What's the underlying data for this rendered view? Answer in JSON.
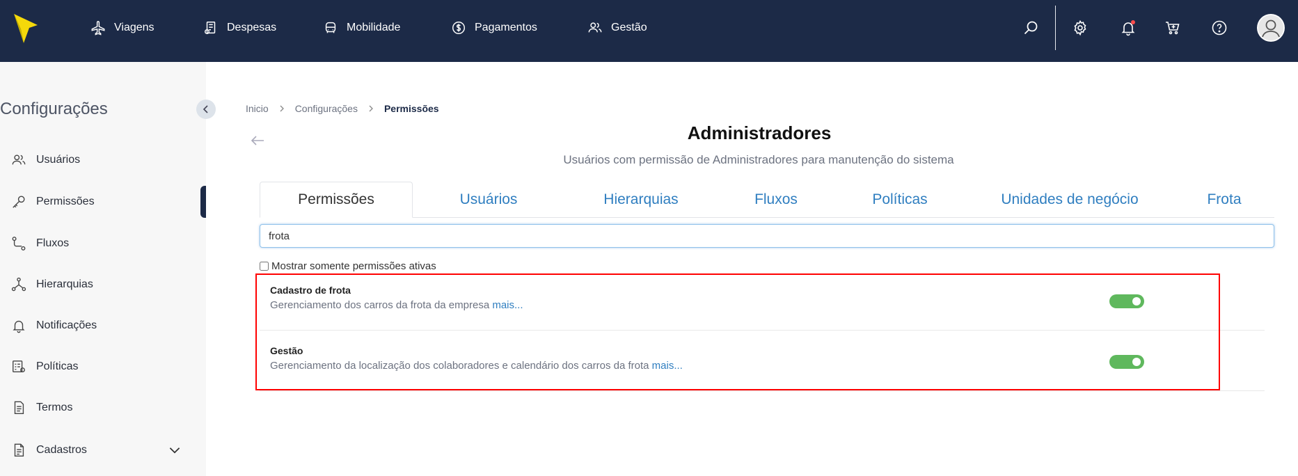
{
  "topnav": {
    "items": [
      {
        "label": "Viagens",
        "icon": "plane-icon"
      },
      {
        "label": "Despesas",
        "icon": "receipt-icon"
      },
      {
        "label": "Mobilidade",
        "icon": "car-icon"
      },
      {
        "label": "Pagamentos",
        "icon": "dollar-icon"
      },
      {
        "label": "Gestão",
        "icon": "people-icon"
      }
    ],
    "tools": [
      "search-icon",
      "gear-icon",
      "bell-icon",
      "cart-icon",
      "help-icon",
      "avatar-icon"
    ],
    "colors": {
      "bar": "#1c2a47",
      "logo": "#f5d90a",
      "notification": "#ff4d4d"
    }
  },
  "sidebar": {
    "title": "Configurações",
    "items": [
      {
        "label": "Usuários",
        "icon": "users-icon"
      },
      {
        "label": "Permissões",
        "icon": "key-icon"
      },
      {
        "label": "Fluxos",
        "icon": "flow-icon"
      },
      {
        "label": "Hierarquias",
        "icon": "hierarchy-icon"
      },
      {
        "label": "Notificações",
        "icon": "bell-icon"
      },
      {
        "label": "Políticas",
        "icon": "policy-icon"
      },
      {
        "label": "Termos",
        "icon": "document-icon"
      },
      {
        "label": "Cadastros",
        "icon": "file-icon"
      }
    ],
    "active": "Permissões"
  },
  "breadcrumb": [
    "Inicio",
    "Configurações",
    "Permissões"
  ],
  "page": {
    "title": "Administradores",
    "subtitle": "Usuários com permissão de Administradores para manutenção do sistema"
  },
  "tabs": [
    {
      "label": "Permissões",
      "active": true
    },
    {
      "label": "Usuários",
      "active": false
    },
    {
      "label": "Hierarquias",
      "active": false
    },
    {
      "label": "Fluxos",
      "active": false
    },
    {
      "label": "Políticas",
      "active": false
    },
    {
      "label": "Unidades de negócio",
      "active": false
    },
    {
      "label": "Frota",
      "active": false
    }
  ],
  "search": {
    "value": "frota"
  },
  "filter": {
    "label": "Mostrar somente permissões ativas",
    "checked": false
  },
  "permissions": [
    {
      "title": "Cadastro de frota",
      "description": "Gerenciamento dos carros da frota da empresa",
      "more": "mais...",
      "enabled": true
    },
    {
      "title": "Gestão",
      "description": "Gerenciamento da localização dos colaboradores e calendário dos carros da frota",
      "more": "mais...",
      "enabled": true
    }
  ],
  "colors": {
    "accent": "#2f7ec0",
    "toggle_on": "#5fb85d",
    "highlight": "#ff0000"
  }
}
